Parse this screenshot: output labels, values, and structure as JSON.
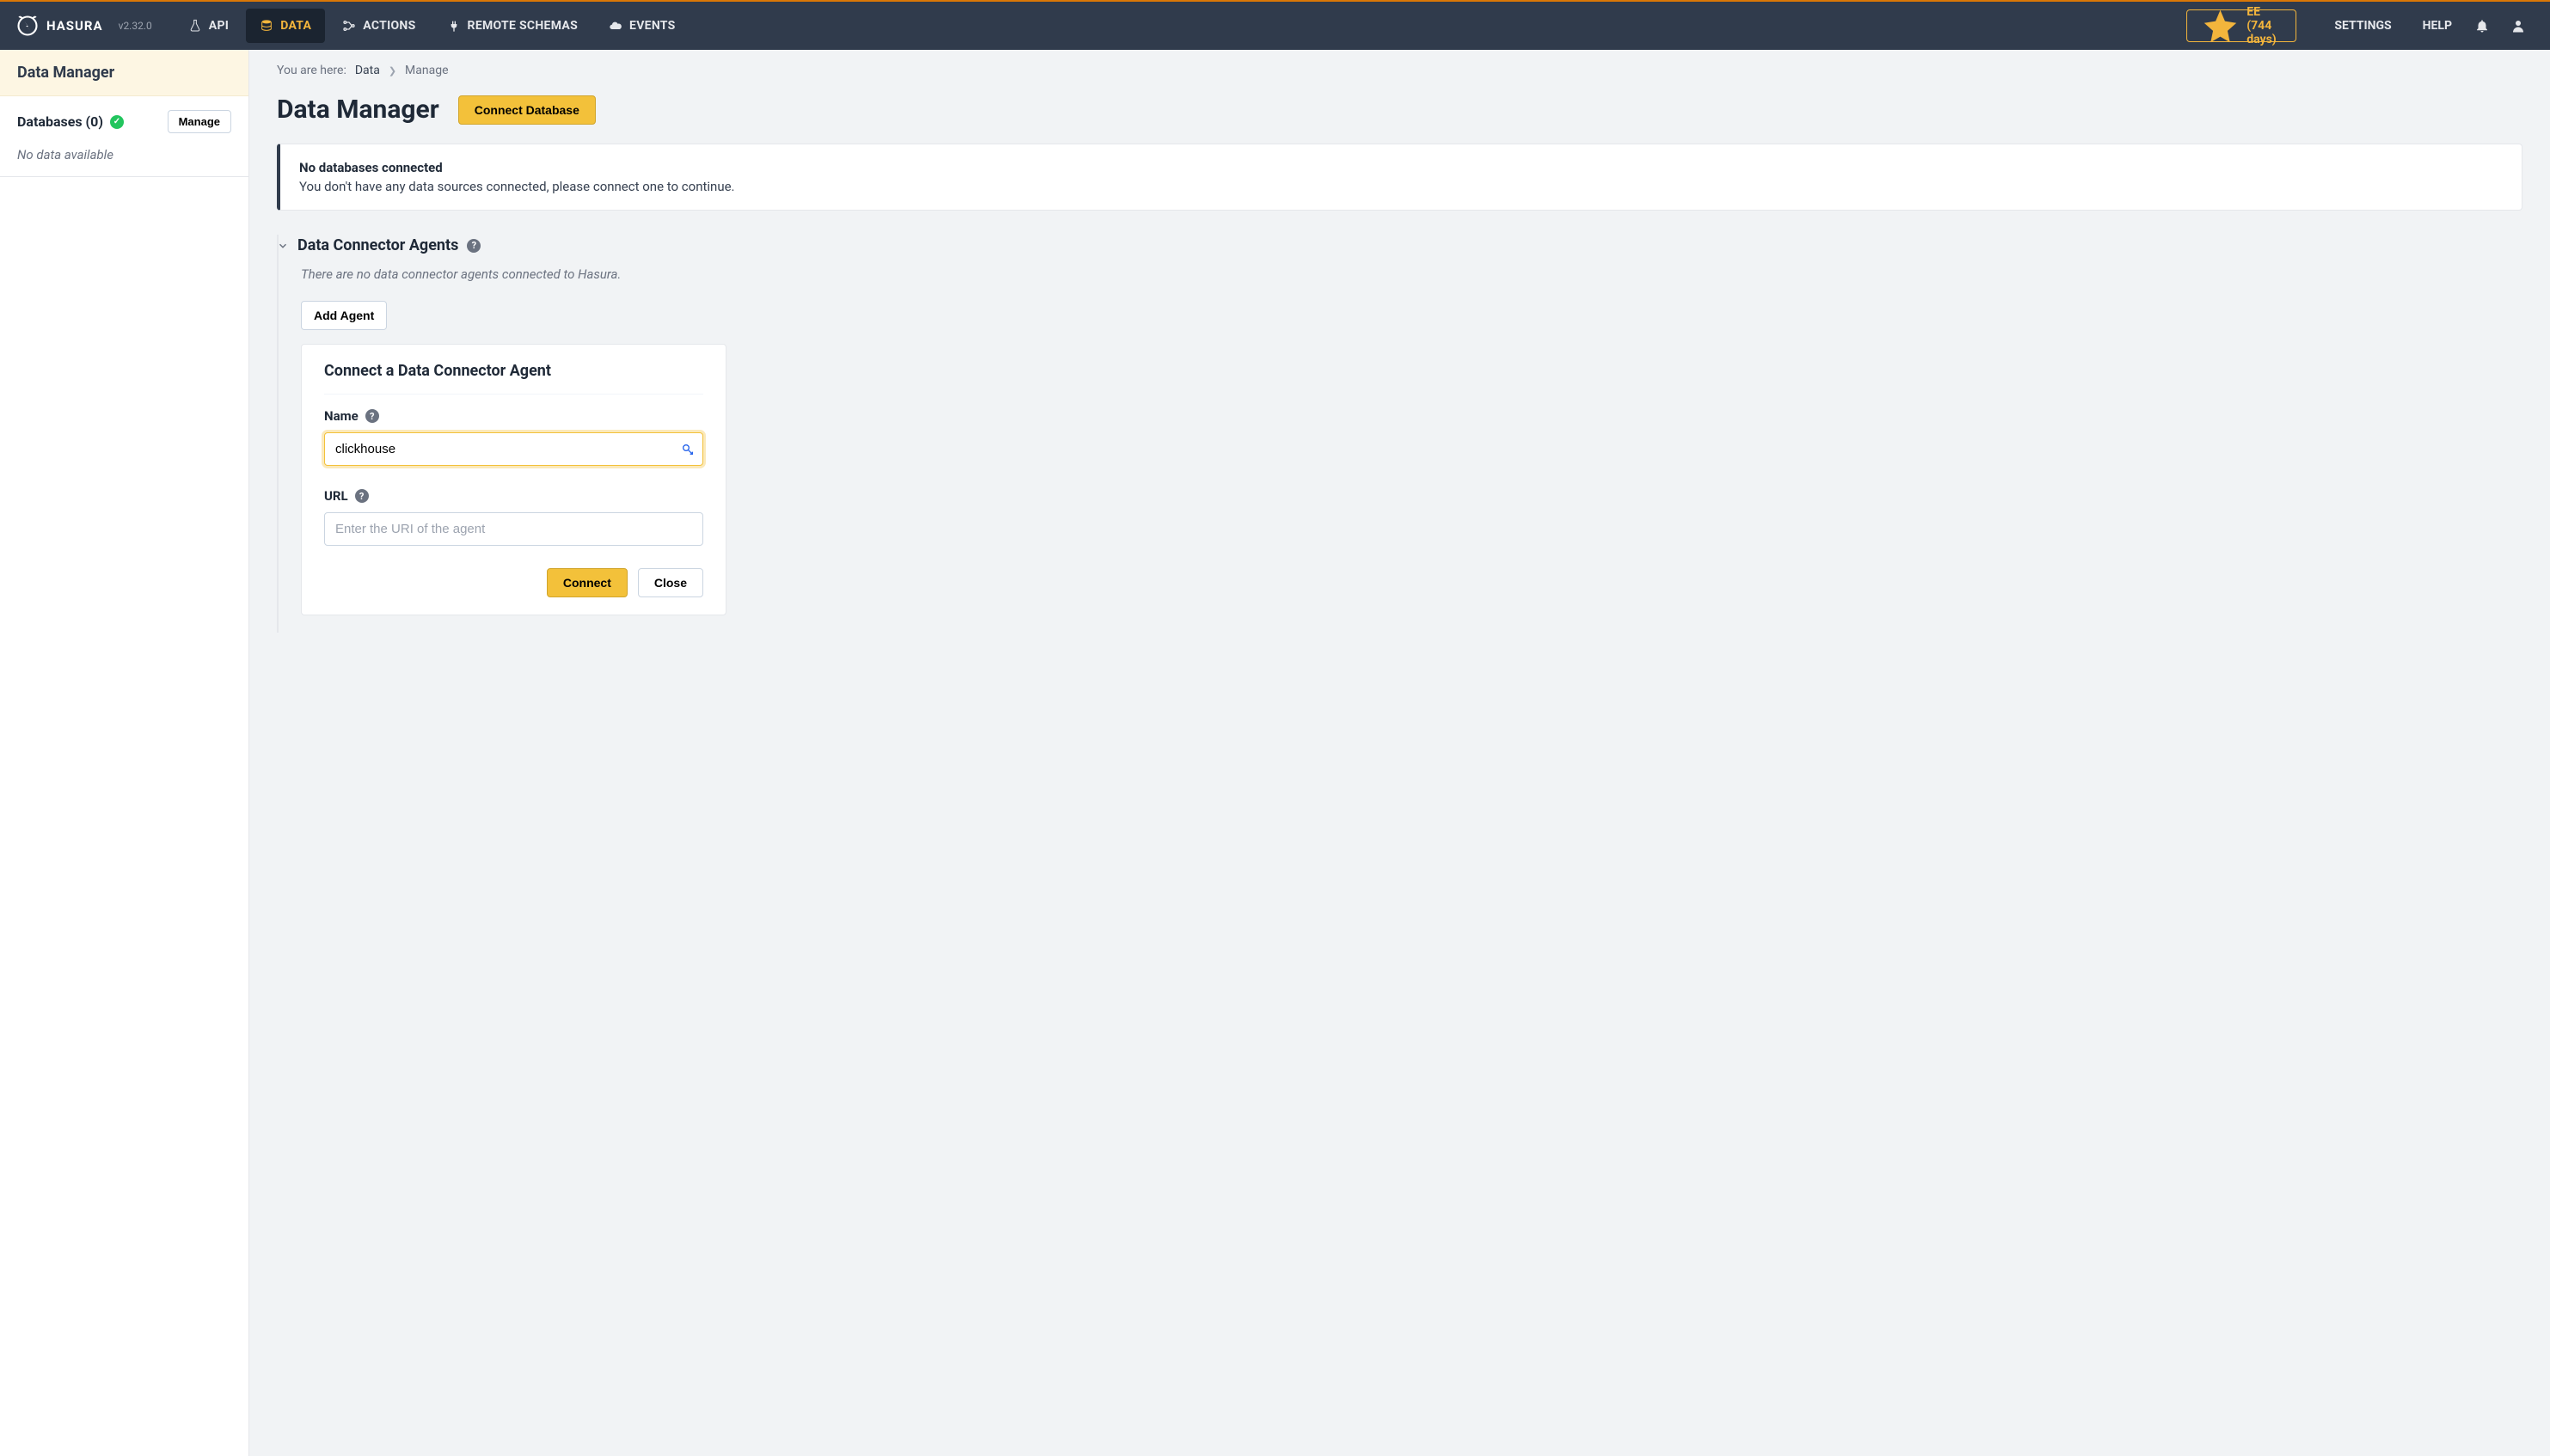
{
  "brand": {
    "name": "HASURA",
    "version": "v2.32.0"
  },
  "nav": {
    "tabs": [
      {
        "label": "API"
      },
      {
        "label": "DATA"
      },
      {
        "label": "ACTIONS"
      },
      {
        "label": "REMOTE SCHEMAS"
      },
      {
        "label": "EVENTS"
      }
    ],
    "ee_label": "EE (744 days)",
    "settings_label": "SETTINGS",
    "help_label": "HELP"
  },
  "sidebar": {
    "title": "Data Manager",
    "db_heading": "Databases (0)",
    "manage_btn": "Manage",
    "empty_text": "No data available"
  },
  "breadcrumb": {
    "prefix": "You are here: ",
    "link": "Data",
    "current": "Manage"
  },
  "page": {
    "title": "Data Manager",
    "connect_db_btn": "Connect Database"
  },
  "banner": {
    "title": "No databases connected",
    "text": "You don't have any data sources connected, please connect one to continue."
  },
  "section": {
    "title": "Data Connector Agents",
    "empty_text": "There are no data connector agents connected to Hasura.",
    "add_agent_btn": "Add Agent"
  },
  "form": {
    "card_title": "Connect a Data Connector Agent",
    "name_label": "Name",
    "name_value": "clickhouse",
    "url_label": "URL",
    "url_placeholder": "Enter the URI of the agent",
    "url_value": "",
    "connect_btn": "Connect",
    "close_btn": "Close"
  }
}
